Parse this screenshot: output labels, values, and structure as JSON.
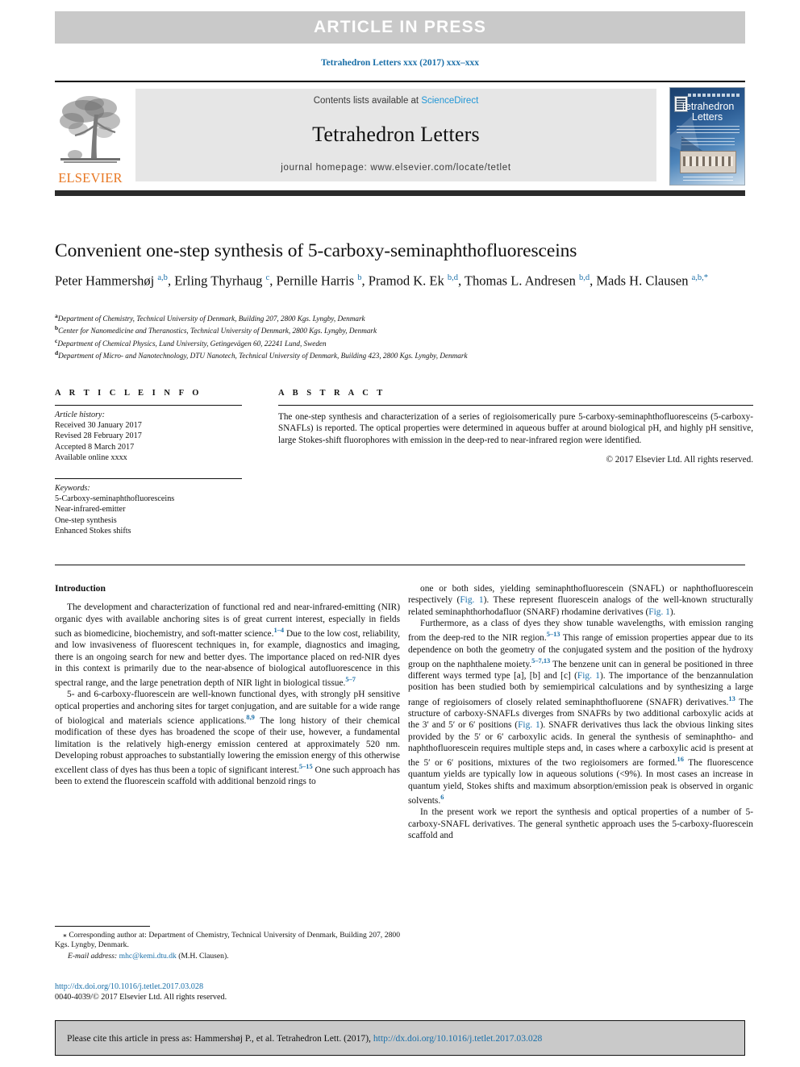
{
  "banner": {
    "text": "ARTICLE  IN  PRESS"
  },
  "running_head": "Tetrahedron Letters xxx (2017) xxx–xxx",
  "masthead": {
    "contents_prefix": "Contents lists available at ",
    "contents_link": "ScienceDirect",
    "journal_title": "Tetrahedron Letters",
    "homepage": "journal homepage: www.elsevier.com/locate/tetlet",
    "publisher": "ELSEVIER",
    "cover": {
      "line1": "Tetrahedron",
      "line2": "Letters"
    }
  },
  "article": {
    "title": "Convenient one-step synthesis of 5-carboxy-seminaphthofluoresceins",
    "authors_html": "Peter Hammershøj <sup>a,b</sup>, Erling Thyrhaug <sup>c</sup>, Pernille Harris <sup>b</sup>, Pramod K. Ek <sup>b,d</sup>, Thomas L. Andresen <sup>b,d</sup>, Mads H. Clausen <sup>a,b,</sup><sup>*</sup>",
    "affiliations": [
      {
        "marker": "a",
        "text": "Department of Chemistry, Technical University of Denmark, Building 207, 2800 Kgs. Lyngby, Denmark"
      },
      {
        "marker": "b",
        "text": "Center for Nanomedicine and Theranostics, Technical University of Denmark, 2800 Kgs. Lyngby, Denmark"
      },
      {
        "marker": "c",
        "text": "Department of Chemical Physics, Lund University, Getingevägen 60, 22241 Lund, Sweden"
      },
      {
        "marker": "d",
        "text": "Department of Micro- and Nanotechnology, DTU Nanotech, Technical University of Denmark, Building 423, 2800 Kgs. Lyngby, Denmark"
      }
    ]
  },
  "article_info": {
    "heading": "A R T I C L E   I N F O",
    "history_label": "Article history:",
    "history": [
      "Received 30 January 2017",
      "Revised 28 February 2017",
      "Accepted 8 March 2017",
      "Available online xxxx"
    ],
    "keywords_label": "Keywords:",
    "keywords": [
      "5-Carboxy-seminaphthofluoresceins",
      "Near-infrared-emitter",
      "One-step synthesis",
      "Enhanced Stokes shifts"
    ]
  },
  "abstract": {
    "heading": "A B S T R A C T",
    "text": "The one-step synthesis and characterization of a series of regioisomerically pure 5-carboxy-seminaphthofluoresceins (5-carboxy-SNAFLs) is reported. The optical properties were determined in aqueous buffer at around biological pH, and highly pH sensitive, large Stokes-shift fluorophores with emission in the deep-red to near-infrared region were identified.",
    "rights": "© 2017 Elsevier Ltd. All rights reserved."
  },
  "body": {
    "section_heading": "Introduction",
    "left_paragraphs_html": [
      "The development and characterization of functional red and near-infrared-emitting (NIR) organic dyes with available anchoring sites is of great current interest, especially in fields such as biomedicine, biochemistry, and soft-matter science.<sup>1&ndash;4</sup> Due to the low cost, reliability, and low invasiveness of fluorescent techniques in, for example, diagnostics and imaging, there is an ongoing search for new and better dyes. The importance placed on red-NIR dyes in this context is primarily due to the near-absence of biological autofluorescence in this spectral range, and the large penetration depth of NIR light in biological tissue.<sup>5&ndash;7</sup>",
      "5- and 6-carboxy-fluorescein are well-known functional dyes, with strongly pH sensitive optical properties and anchoring sites for target conjugation, and are suitable for a wide range of biological and materials science applications.<sup>8,9</sup> The long history of their chemical modification of these dyes has broadened the scope of their use, however, a fundamental limitation is the relatively high-energy emission centered at approximately 520 nm. Developing robust approaches to substantially lowering the emission energy of this otherwise excellent class of dyes has thus been a topic of significant interest.<sup>5&ndash;15</sup> One such approach has been to extend the fluorescein scaffold with additional benzoid rings to"
    ],
    "right_paragraphs_html": [
      "one or both sides, yielding seminaphthofluorescein (SNAFL) or naphthofluorescein respectively (<span class=\"figlink\">Fig. 1</span>). These represent fluorescein analogs of the well-known structurally related seminaphthorhodafluor (SNARF) rhodamine derivatives (<span class=\"figlink\">Fig. 1</span>).",
      "Furthermore, as a class of dyes they show tunable wavelengths, with emission ranging from the deep-red to the NIR region.<sup>5&ndash;13</sup> This range of emission properties appear due to its dependence on both the geometry of the conjugated system and the position of the hydroxy group on the naphthalene moiety.<sup>5&ndash;7,13</sup> The benzene unit can in general be positioned in three different ways termed type [a], [b] and [c] (<span class=\"figlink\">Fig. 1</span>). The importance of the benzannulation position has been studied both by semiempirical calculations and by synthesizing a large range of regioisomers of closely related seminaphthofluorene (SNAFR) derivatives.<sup>13</sup> The structure of carboxy-SNAFLs diverges from SNAFRs by two additional carboxylic acids at the 3&prime; and 5&prime; or 6&prime; positions (<span class=\"figlink\">Fig. 1</span>). SNAFR derivatives thus lack the obvious linking sites provided by the 5&prime; or 6&prime; carboxylic acids. In general the synthesis of seminaphtho- and naphthofluorescein requires multiple steps and, in cases where a carboxylic acid is present at the 5&prime; or 6&prime; positions, mixtures of the two regioisomers are formed.<sup>16</sup> The fluorescence quantum yields are typically low in aqueous solutions (&lt;9%). In most cases an increase in quantum yield, Stokes shifts and maximum absorption/emission peak is observed in organic solvents.<sup>6</sup>",
      "In the present work we report the synthesis and optical properties of a number of 5-carboxy-SNAFL derivatives. The general synthetic approach uses the 5-carboxy-fluorescein scaffold and"
    ]
  },
  "footnote": {
    "corresponding": "⁎ Corresponding author at: Department of Chemistry, Technical University of Denmark, Building 207, 2800 Kgs. Lyngby, Denmark.",
    "email_label": "E-mail address:",
    "email": "mhc@kemi.dtu.dk",
    "email_owner": "(M.H. Clausen).",
    "doi": "http://dx.doi.org/10.1016/j.tetlet.2017.03.028",
    "issn_line": "0040-4039/© 2017 Elsevier Ltd. All rights reserved."
  },
  "cite_bar": {
    "prefix": "Please cite this article in press as: Hammershøj P., et al. Tetrahedron Lett. (2017), ",
    "link": "http://dx.doi.org/10.1016/j.tetlet.2017.03.028"
  },
  "colors": {
    "link": "#1a6fa8",
    "banner_bg": "#c9c9c9",
    "masthead_bg": "#e6e6e6",
    "elsevier_orange": "#e87722"
  }
}
